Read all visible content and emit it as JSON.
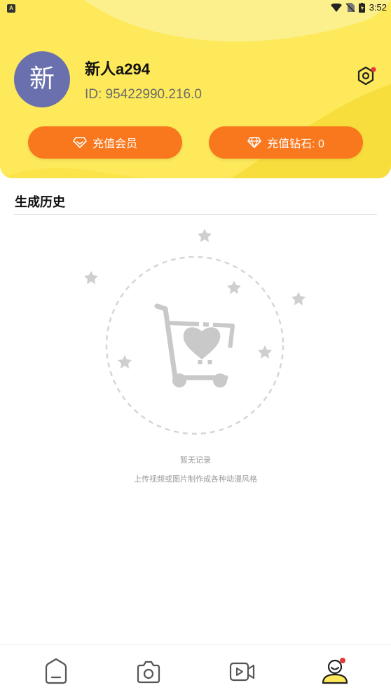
{
  "status_bar": {
    "time": "3:52",
    "left_icon": "A"
  },
  "profile": {
    "avatar_text": "新",
    "username": "新人a294",
    "user_id": "ID: 95422990.216.0"
  },
  "actions": {
    "vip_label": "充值会员",
    "diamond_label": "充值钻石: 0"
  },
  "history": {
    "title": "生成历史",
    "empty_title": "暂无记录",
    "empty_subtitle": "上传视频或图片制作成各种动漫风格"
  },
  "icons": {
    "settings": "settings-icon",
    "vip": "diamond-outline-icon",
    "diamond": "diamond-icon",
    "tabs": [
      "home-icon",
      "camera-icon",
      "video-icon",
      "profile-icon"
    ]
  },
  "colors": {
    "header_bg": "#fde95a",
    "accent_orange": "#f9781d",
    "avatar_bg": "#6a70ad",
    "badge_red": "#e53935"
  }
}
